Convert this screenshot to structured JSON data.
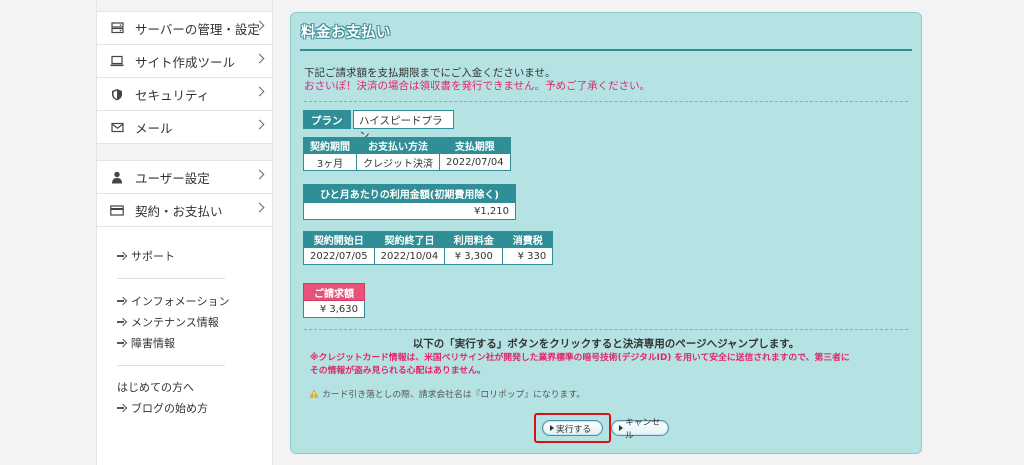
{
  "sidebar": {
    "menu": [
      {
        "label": "サーバーの管理・設定",
        "icon": "server-icon"
      },
      {
        "label": "サイト作成ツール",
        "icon": "laptop-icon"
      },
      {
        "label": "セキュリティ",
        "icon": "shield-icon"
      },
      {
        "label": "メール",
        "icon": "mail-icon"
      }
    ],
    "menu2": [
      {
        "label": "ユーザー設定",
        "icon": "user-icon"
      },
      {
        "label": "契約・お支払い",
        "icon": "card-icon"
      }
    ],
    "support": "サポート",
    "info_links": [
      "インフォメーション",
      "メンテナンス情報",
      "障害情報"
    ],
    "beginner_heading": "はじめての方へ",
    "blog_link": "ブログの始め方"
  },
  "panel": {
    "title": "料金お支払い",
    "intro_line1": "下記ご請求額を支払期限までにご入金くださいませ。",
    "intro_line2": "おさいぽ！決済の場合は領収書を発行できません。予めご了承ください。",
    "plan_label": "プラン",
    "plan_value": "ハイスピードプラン",
    "contract_table": {
      "headers": [
        "契約期間",
        "お支払い方法",
        "支払期限"
      ],
      "values": [
        "3ヶ月",
        "クレジット決済",
        "2022/07/04"
      ]
    },
    "monthly": {
      "header": "ひと月あたりの利用金額(初期費用除く)",
      "value": "¥1,210"
    },
    "term_table": {
      "headers": [
        "契約開始日",
        "契約終了日",
        "利用料金",
        "消費税"
      ],
      "values": [
        "2022/07/05",
        "2022/10/04",
        "¥ 3,300",
        "¥ 330"
      ]
    },
    "billing": {
      "header": "ご請求額",
      "value": "¥ 3,630"
    },
    "notice": "以下の「実行する」ボタンをクリックすると決済専用のページへジャンプします。",
    "warning_line1": "※クレジットカード情報は、米国ベリサイン社が開発した業界標準の暗号技術(デジタルID) を用いて安全に送信されますので、第三者に",
    "warning_line2": "その情報が盗み見られる心配はありません。",
    "card_note": "カード引き落としの際、請求会社名は『ロリポップ』になります。",
    "execute_button": "実行する",
    "cancel_button": "キャンセル"
  },
  "colors": {
    "panel_bg": "#b5e3e3",
    "header_teal": "#2f8e96",
    "alert_pink": "#e0266b",
    "highlight_red": "#d41414"
  }
}
